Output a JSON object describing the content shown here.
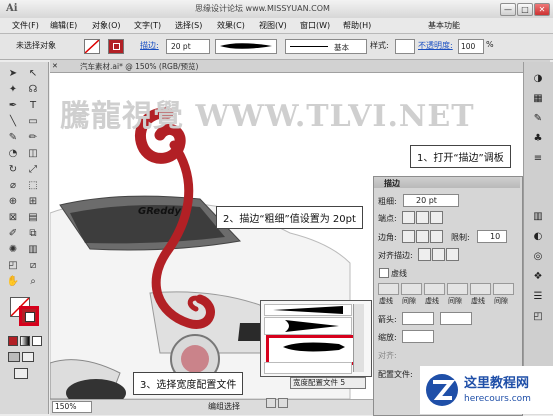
{
  "titlebar": {
    "app_logo": "Ai",
    "watermark": "思缘设计论坛 www.MISSYUAN.COM",
    "workspace": "基本功能",
    "min": "—",
    "max": "□",
    "close": "✕"
  },
  "menu": {
    "items": [
      "文件(F)",
      "编辑(E)",
      "对象(O)",
      "文字(T)",
      "选择(S)",
      "效果(C)",
      "视图(V)",
      "窗口(W)",
      "帮助(H)"
    ]
  },
  "control": {
    "selection": "未选择对象",
    "stroke_label": "描边:",
    "stroke_weight": "20 pt",
    "profile_label": "基本",
    "style_label": "样式:",
    "opacity_label": "不透明度:",
    "opacity_value": "100",
    "opacity_unit": "%",
    "colors": {
      "stroke": "#b22025",
      "fill": "#ffffff"
    }
  },
  "document": {
    "tab_label": "汽车素材.ai* @ 150% (RGB/预览)",
    "site_watermark": "騰龍視覺 WWW.TLVI.NET",
    "car_brand": "GReddy",
    "zoom": "150%",
    "status_text": "编组选择"
  },
  "callouts": {
    "step1": "1、打开“描边”调板",
    "step2": "2、描边“粗细”值设置为 20pt",
    "step3": "3、选择宽度配置文件"
  },
  "stroke_panel": {
    "title": "描边",
    "weight_label": "粗细:",
    "weight_value": "20 pt",
    "cap_label": "端点:",
    "corner_label": "边角:",
    "limit_label": "限制:",
    "limit_value": "10",
    "align_label": "对齐描边:",
    "dashed_label": "虚线",
    "dash_cols": [
      "虚线",
      "间隙",
      "虚线",
      "间隙",
      "虚线",
      "间隙"
    ],
    "arrow_label": "箭头:",
    "scale_label": "缩放:",
    "align2_label": "对齐:",
    "profile_label": "配置文件:"
  },
  "profile_popup": {
    "selected": "宽度配置文件 5"
  },
  "logo": {
    "brand": "这里教程网",
    "url": "herecours.com",
    "accent": "#1f4fa8"
  }
}
